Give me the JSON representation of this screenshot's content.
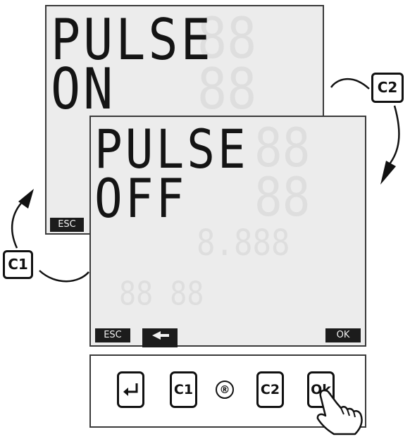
{
  "back_screen": {
    "line1": "PULSE",
    "line2": "ON",
    "esc_label": "ESC"
  },
  "front_screen": {
    "line1": "PULSE",
    "line2": "OFF",
    "esc_label": "ESC",
    "back_arrow_icon": "left-arrow-icon",
    "ok_label": "OK"
  },
  "nav_labels": {
    "c1": "C1",
    "c2": "C2"
  },
  "keypad": {
    "enter_icon": "return-arrow-icon",
    "c1": "C1",
    "registered": "®",
    "c2": "C2",
    "ok": "Ok",
    "pointer_icon": "hand-pointer-icon"
  }
}
